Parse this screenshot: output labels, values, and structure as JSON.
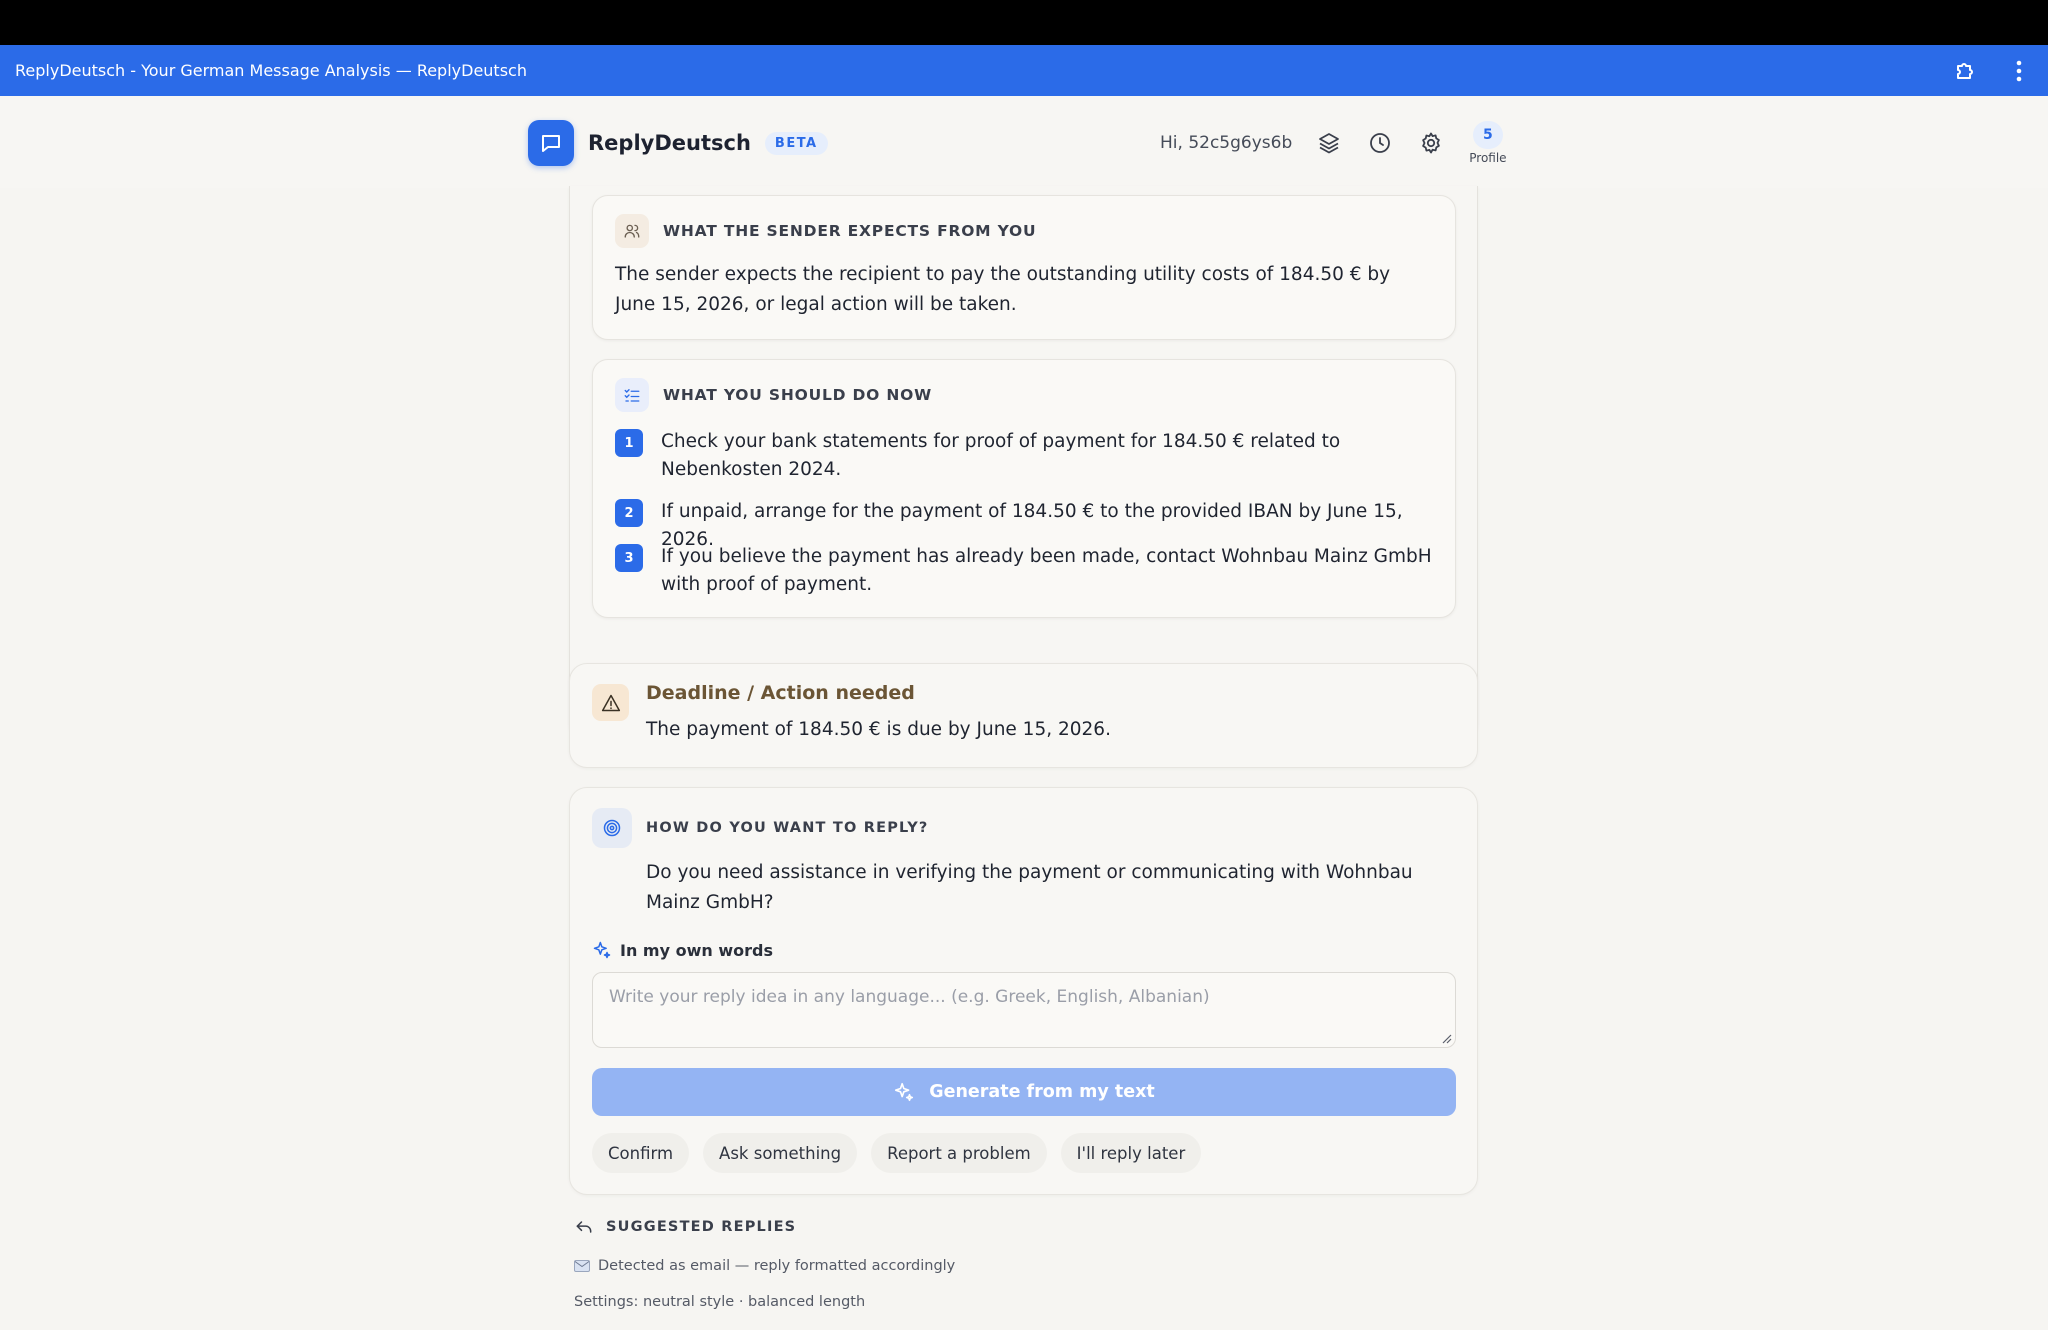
{
  "window": {
    "title": "ReplyDeutsch - Your German Message Analysis — ReplyDeutsch"
  },
  "header": {
    "brand": "ReplyDeutsch",
    "badge": "BETA",
    "greeting": "Hi, 52c5g6ys6b",
    "profile_count": "5",
    "profile_label": "Profile"
  },
  "expectations": {
    "title": "WHAT THE SENDER EXPECTS FROM YOU",
    "text": "The sender expects the recipient to pay the outstanding utility costs of 184.50 € by June 15, 2026, or legal action will be taken."
  },
  "actions": {
    "title": "WHAT YOU SHOULD DO NOW",
    "steps": [
      {
        "num": "1",
        "text": "Check your bank statements for proof of payment for 184.50 € related to Nebenkosten 2024."
      },
      {
        "num": "2",
        "text": "If unpaid, arrange for the payment of 184.50 € to the provided IBAN by June 15, 2026."
      },
      {
        "num": "3",
        "text": "If you believe the payment has already been made, contact Wohnbau Mainz GmbH with proof of payment."
      }
    ]
  },
  "deadline": {
    "title": "Deadline / Action needed",
    "text": "The payment of 184.50 € is due by June 15, 2026."
  },
  "reply": {
    "title": "HOW DO YOU WANT TO REPLY?",
    "question": "Do you need assistance in verifying the payment or communicating with Wohnbau Mainz GmbH?",
    "own_words_label": "In my own words",
    "input_placeholder": "Write your reply idea in any language... (e.g. Greek, English, Albanian)",
    "input_value": "",
    "generate_label": "Generate from my text",
    "quick_replies": [
      "Confirm",
      "Ask something",
      "Report a problem",
      "I'll reply later"
    ]
  },
  "suggested": {
    "title": "SUGGESTED REPLIES",
    "detected": "Detected as email — reply formatted accordingly",
    "settings": "Settings: neutral style · balanced length"
  },
  "colors": {
    "accent": "#2b6be8",
    "button_disabled": "#94b4f3",
    "warning_chip": "#f7e7d3",
    "deadline_text": "#6b5535"
  },
  "icons": {
    "logo": "chat-bubble-icon",
    "extensions": "puzzle-icon",
    "menu": "more-vertical-icon",
    "layers": "layers-icon",
    "history": "clock-icon",
    "settings": "gear-icon",
    "expectations": "users-icon",
    "actions": "checklist-icon",
    "deadline": "warning-triangle-icon",
    "reply": "target-icon",
    "own_words": "sparkle-icon",
    "generate": "sparkle-icon",
    "suggested": "reply-arrow-icon",
    "detected": "envelope-icon"
  }
}
